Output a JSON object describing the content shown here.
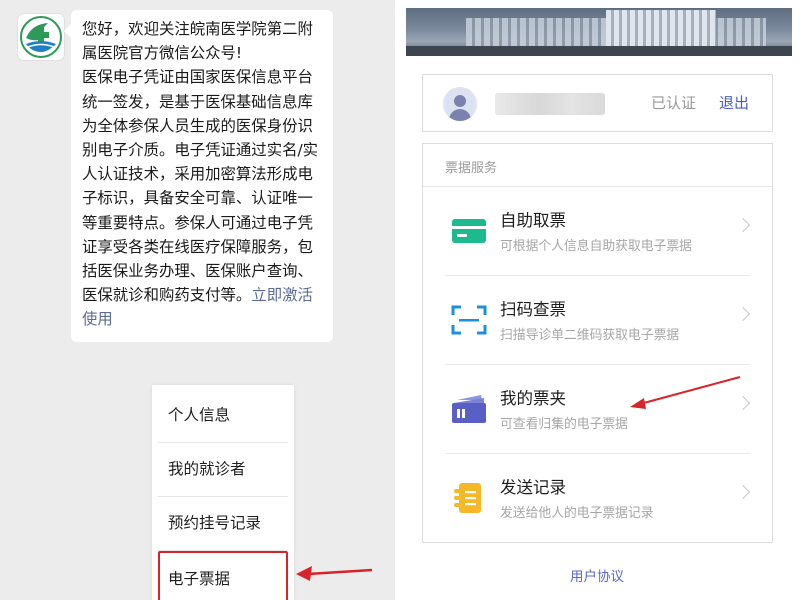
{
  "chat": {
    "message_lines": [
      "您好，欢迎关注皖南医学院第二附",
      "属医院官方微信公众号!",
      "医保电子凭证由国家医保信息平台",
      "统一签发，是基于医保基础信息库",
      "为全体参保人员生成的医保身份识",
      "别电子介质。电子凭证通过实名/实",
      "人认证技术，采用加密算法形成电",
      "子标识，具备安全可靠、认证唯一",
      "等重要特点。参保人可通过电子凭",
      "证享受各类在线医疗保障服务，包",
      "括医保业务办理、医保账户查询、"
    ],
    "message_tail": "医保就诊和购药支付等。",
    "activate_link_part1": "立即激活",
    "activate_link_part2": "使用"
  },
  "menu": {
    "items": [
      {
        "label": "个人信息"
      },
      {
        "label": "我的就诊者"
      },
      {
        "label": "预约挂号记录"
      },
      {
        "label": "电子票据"
      }
    ]
  },
  "user": {
    "status": "已认证",
    "logout_label": "退出"
  },
  "services": {
    "section_title": "票据服务",
    "items": [
      {
        "name": "自助取票",
        "desc": "可根据个人信息自助获取电子票据",
        "icon": "ticket-card-icon"
      },
      {
        "name": "扫码查票",
        "desc": "扫描导诊单二维码获取电子票据",
        "icon": "scan-frame-icon"
      },
      {
        "name": "我的票夹",
        "desc": "可查看归集的电子票据",
        "icon": "ticket-folder-icon"
      },
      {
        "name": "发送记录",
        "desc": "发送给他人的电子票据记录",
        "icon": "send-record-icon"
      }
    ]
  },
  "footer": {
    "protocol_label": "用户协议"
  },
  "colors": {
    "accent_blue": "#4a5bd0",
    "highlight_red": "#d9232b",
    "green_icon": "#1db98f",
    "cyan_icon": "#1b8fe0",
    "indigo_icon": "#5860c6",
    "yellow_icon": "#f5b928"
  }
}
